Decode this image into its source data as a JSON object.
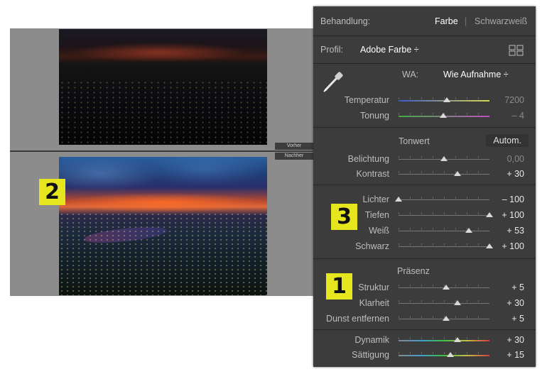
{
  "before_label": "Vorher",
  "after_label": "Nachher",
  "badges": [
    "2",
    "3",
    "1"
  ],
  "header": {
    "title": "Behandlung:",
    "opt_color": "Farbe",
    "divider": "|",
    "opt_bw": "Schwarzweiß"
  },
  "profile": {
    "label": "Profil:",
    "value": "Adobe Farbe ÷"
  },
  "wb": {
    "label": "WA:",
    "value": "Wie Aufnahme ÷"
  },
  "groups": {
    "wb_sliders": [
      {
        "label": "Temperatur",
        "value": "7200",
        "pos": 0.53,
        "dim": true,
        "track": "temp"
      },
      {
        "label": "Tonung",
        "value": "– 4",
        "pos": 0.49,
        "dim": true,
        "track": "tint"
      }
    ],
    "tone_title": "Tonwert",
    "auto": "Autom.",
    "tone_sliders": [
      {
        "label": "Belichtung",
        "value": "0,00",
        "pos": 0.5,
        "dim": true
      },
      {
        "label": "Kontrast",
        "value": "+ 30",
        "pos": 0.65,
        "dim": false
      }
    ],
    "detail_sliders": [
      {
        "label": "Lichter",
        "value": "– 100",
        "pos": 0.0,
        "dim": false
      },
      {
        "label": "Tiefen",
        "value": "+ 100",
        "pos": 1.0,
        "dim": false
      },
      {
        "label": "Weiß",
        "value": "+ 53",
        "pos": 0.77,
        "dim": false
      },
      {
        "label": "Schwarz",
        "value": "+ 100",
        "pos": 1.0,
        "dim": false
      }
    ],
    "presence_title": "Präsenz",
    "presence_sliders": [
      {
        "label": "Struktur",
        "value": "+ 5",
        "pos": 0.52,
        "dim": false
      },
      {
        "label": "Klarheit",
        "value": "+ 30",
        "pos": 0.65,
        "dim": false
      },
      {
        "label": "Dunst entfernen",
        "value": "+ 5",
        "pos": 0.52,
        "dim": false
      }
    ],
    "color_sliders": [
      {
        "label": "Dynamik",
        "value": "+ 30",
        "pos": 0.65,
        "dim": false,
        "track": "sat"
      },
      {
        "label": "Sättigung",
        "value": "+ 15",
        "pos": 0.57,
        "dim": false,
        "track": "sat"
      }
    ]
  },
  "colors": {
    "panel": "#3c3c3c",
    "badge": "#e6e61e",
    "canvas": "#8c8c8c"
  }
}
